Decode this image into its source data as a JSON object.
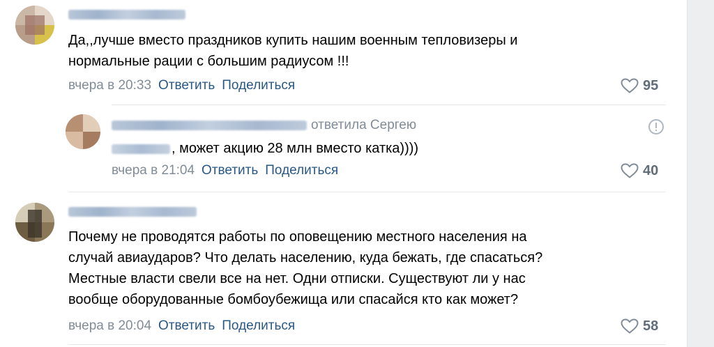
{
  "comments": [
    {
      "text_lines": [
        "Да,,лучше вместо праздников купить нашим военным тепловизеры и",
        "нормальные рации с большим радиусом !!!"
      ],
      "time": "вчера в 20:33",
      "reply_label": "Ответить",
      "share_label": "Поделиться",
      "likes": "95",
      "icon": "heart-icon"
    },
    {
      "replied_to": "ответила Сергею",
      "text": ", может акцию 28 млн вместо катка))))",
      "time": "вчера в 21:04",
      "reply_label": "Ответить",
      "share_label": "Поделиться",
      "likes": "40",
      "icon": "heart-icon"
    },
    {
      "text_lines": [
        "Почему не проводятся работы по оповещению местного населения на",
        "случай авиаударов? Что делать населению, куда бежать, где спасаться?",
        "Местные власти свели все на нет. Одни отписки. Существуют ли у нас",
        "вообще оборудованные бомбоубежища или спасайся кто как может?"
      ],
      "time": "вчера в 20:04",
      "reply_label": "Ответить",
      "share_label": "Поделиться",
      "likes": "58",
      "icon": "heart-icon"
    }
  ],
  "colors": {
    "link": "#2a5885",
    "meta": "#818c99",
    "like_count": "#626d7a",
    "divider": "#e7e8ec",
    "gutter": "#edeef0"
  }
}
